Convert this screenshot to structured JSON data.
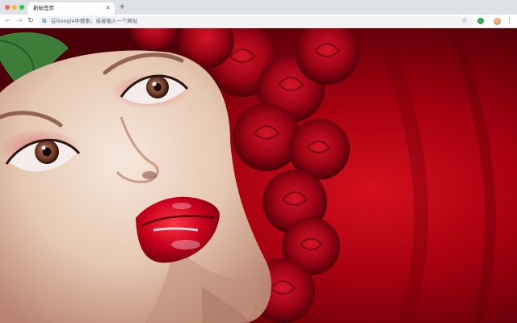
{
  "window": {
    "controls": [
      "close",
      "minimize",
      "maximize"
    ]
  },
  "tabs": [
    {
      "title": "新标签页",
      "close_glyph": "×",
      "active": true
    }
  ],
  "tabstrip": {
    "new_tab_glyph": "+"
  },
  "toolbar": {
    "back_glyph": "←",
    "forward_glyph": "→",
    "reload_glyph": "↻",
    "omnibox_icon": "G",
    "omnibox_placeholder": "在Google中搜索，或者输入一个网址",
    "bookmark_glyph": "☆",
    "menu_glyph": "⋮"
  },
  "colors": {
    "tabstrip_bg": "#dee1e6",
    "toolbar_bg": "#ffffff",
    "omnibox_bg": "#f1f3f4",
    "wallpaper_red": "#b0000f",
    "lip_red": "#c8001c"
  },
  "wallpaper": {
    "subject": "woman-with-red-roses"
  }
}
